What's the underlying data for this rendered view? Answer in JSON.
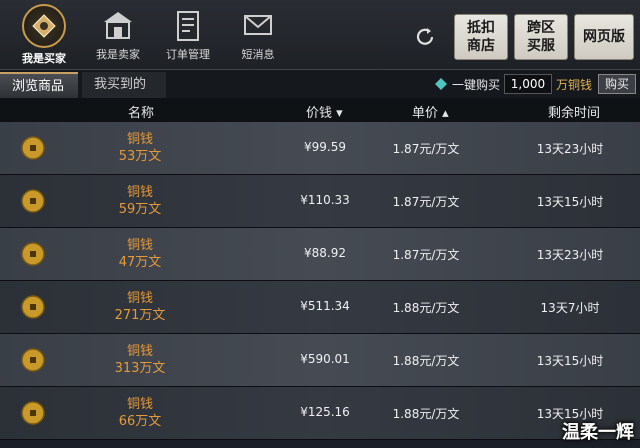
{
  "nav": {
    "items": [
      {
        "label": "我是买家",
        "icon": "buyer-icon"
      },
      {
        "label": "我是卖家",
        "icon": "seller-icon"
      },
      {
        "label": "订单管理",
        "icon": "order-icon"
      },
      {
        "label": "短消息",
        "icon": "message-icon"
      }
    ],
    "right_buttons": [
      "抵扣\n商店",
      "跨区\n买服",
      "网页版"
    ]
  },
  "tabs": [
    "浏览商品",
    "我买到的"
  ],
  "quick_buy": {
    "label": "一键购买",
    "quantity": "1,000",
    "unit": "万铜钱",
    "button": "购买"
  },
  "table": {
    "headers": [
      "名称",
      "价钱",
      "单价",
      "剩余时间"
    ],
    "rows": [
      {
        "name": "铜钱",
        "amount": "53万文",
        "price": "¥99.59",
        "unit_price": "1.87元/万文",
        "time": "13天23小时"
      },
      {
        "name": "铜钱",
        "amount": "59万文",
        "price": "¥110.33",
        "unit_price": "1.87元/万文",
        "time": "13天15小时"
      },
      {
        "name": "铜钱",
        "amount": "47万文",
        "price": "¥88.92",
        "unit_price": "1.87元/万文",
        "time": "13天23小时"
      },
      {
        "name": "铜钱",
        "amount": "271万文",
        "price": "¥511.34",
        "unit_price": "1.88元/万文",
        "time": "13天7小时"
      },
      {
        "name": "铜钱",
        "amount": "313万文",
        "price": "¥590.01",
        "unit_price": "1.88元/万文",
        "time": "13天15小时"
      },
      {
        "name": "铜钱",
        "amount": "66万文",
        "price": "¥125.16",
        "unit_price": "1.88元/万文",
        "time": "13天15小时"
      }
    ]
  },
  "watermark": "温柔一辉",
  "colors": {
    "accent": "#c79b4b",
    "item_text": "#e59a3a",
    "currency_unit": "#e2b152"
  }
}
